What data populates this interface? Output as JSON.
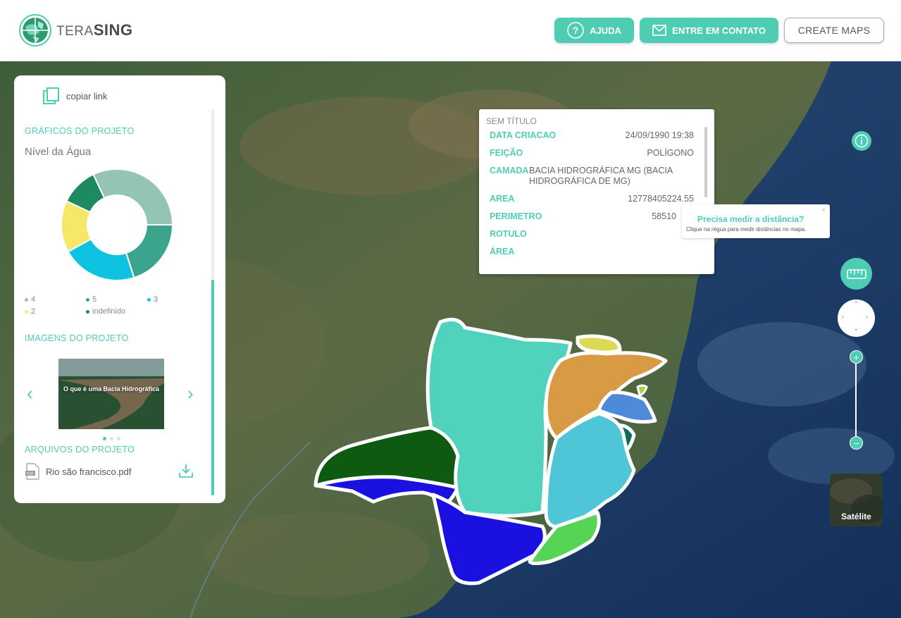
{
  "header": {
    "logo_prefix": "TERA",
    "logo_bold": "SING",
    "help_label": "AJUDA",
    "contact_label": "ENTRE EM CONTATO",
    "create_label": "CREATE MAPS"
  },
  "panel": {
    "copy_link": "copiar link",
    "charts_title": "GRÁFICOS DO PROJETO",
    "chart_title": "Nível da Água",
    "legend": [
      {
        "label": "4",
        "color": "#93c4b4"
      },
      {
        "label": "5",
        "color": "#3aa58c"
      },
      {
        "label": "3",
        "color": "#0ec2e2"
      },
      {
        "label": "2",
        "color": "#f7e768"
      },
      {
        "label": "indefinido",
        "color": "#1e8a60"
      }
    ],
    "images_title": "IMAGENS DO PROJETO",
    "image_caption": "O que é uma Bacia Hidrográfica",
    "files_title": "ARQUIVOS DO PROJETO",
    "file_name": "Rio são francisco.pdf"
  },
  "chart_data": {
    "type": "pie",
    "title": "Nível da Água",
    "categories": [
      "4",
      "5",
      "3",
      "2",
      "indefinido"
    ],
    "values": [
      32,
      20,
      22,
      15,
      11
    ],
    "colors": [
      "#93c4b4",
      "#3aa58c",
      "#0ec2e2",
      "#f7e768",
      "#1e8a60"
    ]
  },
  "popup": {
    "title": "SEM TÍTULO",
    "rows": [
      {
        "key": "DATA CRIACAO",
        "value": "24/09/1990 19:38"
      },
      {
        "key": "FEIÇÃO",
        "value": "POLÍGONO"
      },
      {
        "key": "CAMADA",
        "value": "BACIA HIDROGRÁFICA MG (BACIA HIDROGRÁFICA DE MG)"
      },
      {
        "key": "AREA",
        "value": "12778405224.55"
      },
      {
        "key": "PERIMETRO",
        "value": "58510"
      },
      {
        "key": "ROTULO",
        "value": ""
      },
      {
        "key": "ÁREA",
        "value": ""
      }
    ]
  },
  "tooltip": {
    "title": "Precisa medir a distância?",
    "text": "Clique na régua para medir distâncias no mapa.",
    "close": "×"
  },
  "controls": {
    "zoom_in": "+",
    "zoom_out": "−",
    "satellite_label": "Satélite"
  }
}
